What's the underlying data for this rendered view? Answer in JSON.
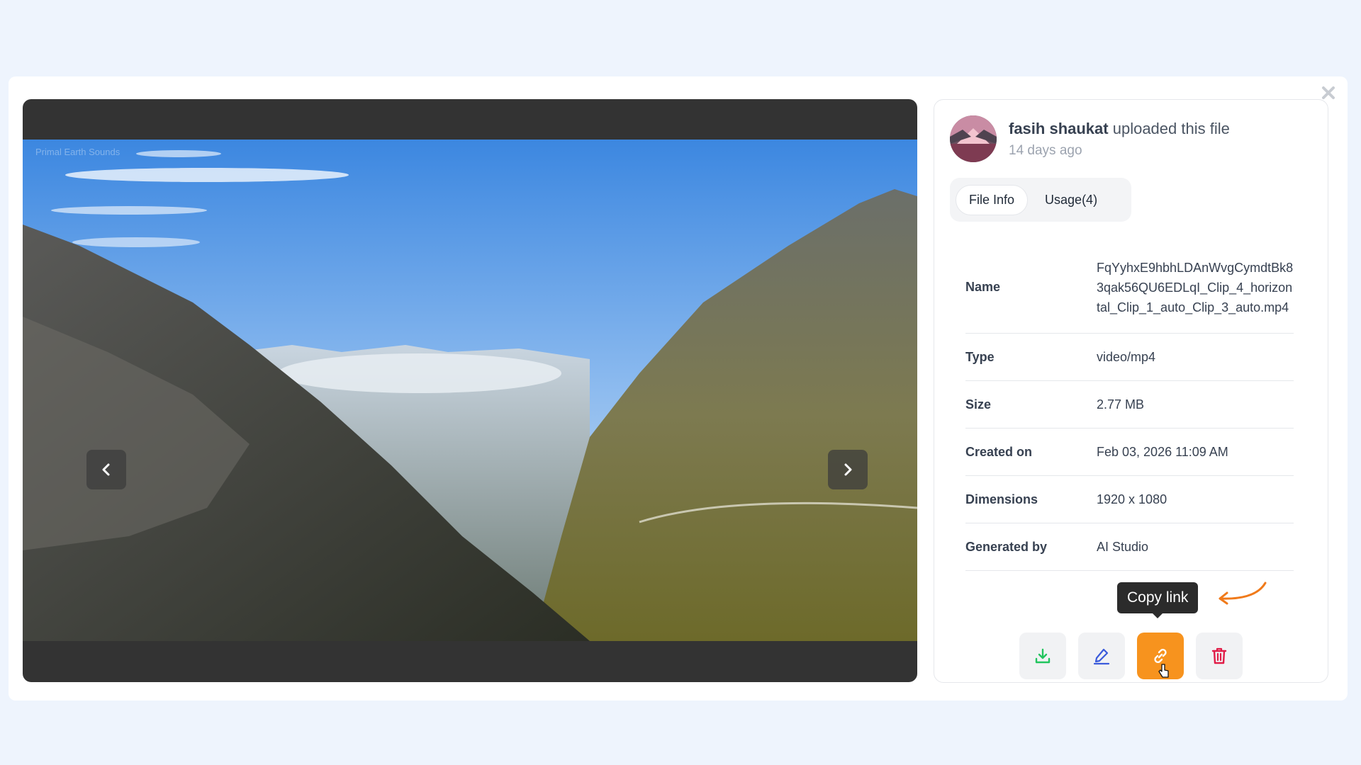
{
  "modal": {
    "close_icon": "close-icon"
  },
  "viewer": {
    "watermark": "Primal Earth Sounds",
    "prev_icon": "chevron-left-icon",
    "next_icon": "chevron-right-icon"
  },
  "uploader": {
    "name": "fasih shaukat",
    "action_text": " uploaded this file",
    "time": "14 days ago"
  },
  "tabs": [
    {
      "label": "File Info",
      "active": true
    },
    {
      "label": "Usage(4)",
      "active": false
    }
  ],
  "file_info": {
    "rows": [
      {
        "label": "Name",
        "value": "FqYyhxE9hbhLDAnWvgCymdtBk83qak56QU6EDLqI_Clip_4_horizontal_Clip_1_auto_Clip_3_auto.mp4"
      },
      {
        "label": "Type",
        "value": "video/mp4"
      },
      {
        "label": "Size",
        "value": "2.77 MB"
      },
      {
        "label": "Created on",
        "value": "Feb 03, 2026 11:09 AM"
      },
      {
        "label": "Dimensions",
        "value": "1920 x 1080"
      },
      {
        "label": "Generated by",
        "value": "AI Studio"
      }
    ]
  },
  "tooltip": {
    "text": "Copy link"
  },
  "actions": [
    {
      "name": "download",
      "icon": "download-icon",
      "color": "#22c55e"
    },
    {
      "name": "edit",
      "icon": "pencil-icon",
      "color": "#3b5bdb"
    },
    {
      "name": "copy-link",
      "icon": "link-icon",
      "color": "#ffffff"
    },
    {
      "name": "delete",
      "icon": "trash-icon",
      "color": "#e11d48"
    }
  ],
  "colors": {
    "accent": "#f7931e",
    "annotation": "#f07a1a"
  }
}
